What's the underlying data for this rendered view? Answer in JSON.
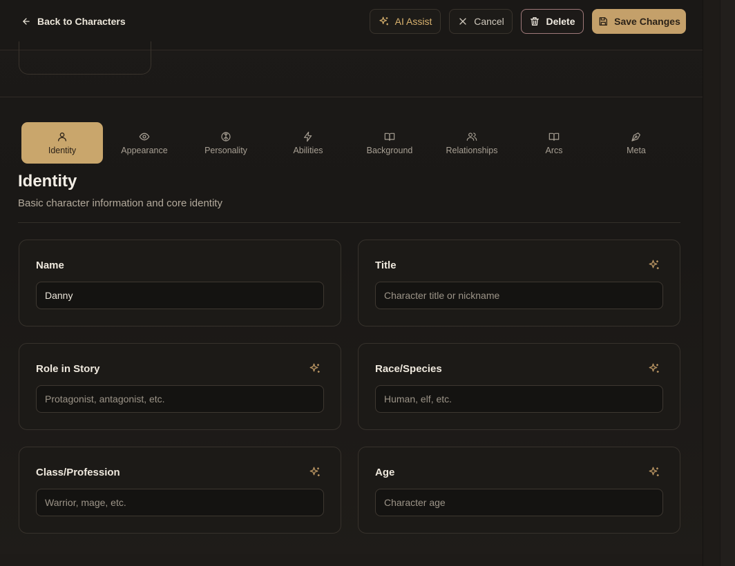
{
  "header": {
    "back_label": "Back to Characters",
    "ai_assist_label": "AI Assist",
    "cancel_label": "Cancel",
    "delete_label": "Delete",
    "save_label": "Save Changes"
  },
  "tabs": [
    {
      "label": "Identity",
      "icon": "user-icon",
      "active": true
    },
    {
      "label": "Appearance",
      "icon": "eye-icon",
      "active": false
    },
    {
      "label": "Personality",
      "icon": "brain-icon",
      "active": false
    },
    {
      "label": "Abilities",
      "icon": "lightning-icon",
      "active": false
    },
    {
      "label": "Background",
      "icon": "book-open-icon",
      "active": false
    },
    {
      "label": "Relationships",
      "icon": "users-icon",
      "active": false
    },
    {
      "label": "Arcs",
      "icon": "book-open-icon",
      "active": false
    },
    {
      "label": "Meta",
      "icon": "pen-nib-icon",
      "active": false
    }
  ],
  "section": {
    "title": "Identity",
    "subtitle": "Basic character information and core identity"
  },
  "fields": [
    {
      "label": "Name",
      "value": "Danny",
      "placeholder": "",
      "ai_assist": false
    },
    {
      "label": "Title",
      "value": "",
      "placeholder": "Character title or nickname",
      "ai_assist": true
    },
    {
      "label": "Role in Story",
      "value": "",
      "placeholder": "Protagonist, antagonist, etc.",
      "ai_assist": true
    },
    {
      "label": "Race/Species",
      "value": "",
      "placeholder": "Human, elf, etc.",
      "ai_assist": true
    },
    {
      "label": "Class/Profession",
      "value": "",
      "placeholder": "Warrior, mage, etc.",
      "ai_assist": true
    },
    {
      "label": "Age",
      "value": "",
      "placeholder": "Character age",
      "ai_assist": true
    }
  ],
  "colors": {
    "accent": "#c9a66c",
    "background": "#1b1917",
    "danger_border": "#a07a7a"
  }
}
